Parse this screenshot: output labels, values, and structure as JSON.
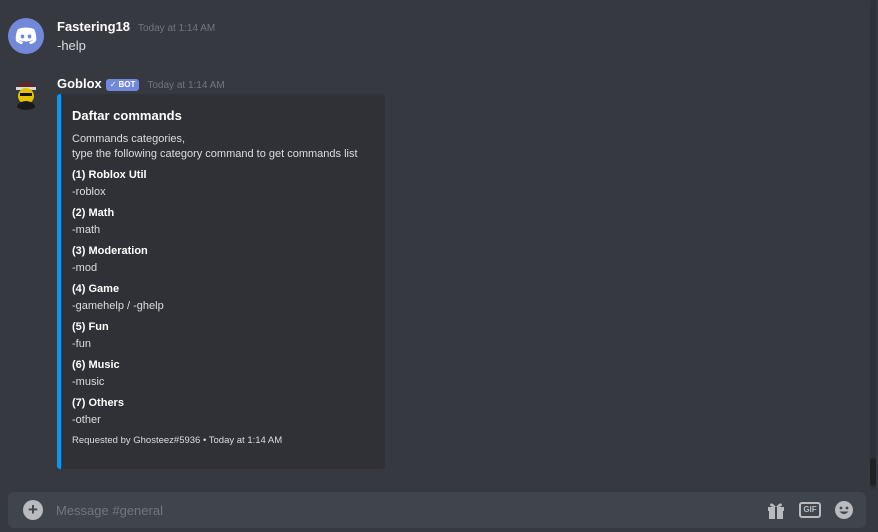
{
  "messages": [
    {
      "username": "Fastering18",
      "timestamp": "Today at 1:14 AM",
      "content": "-help",
      "avatar_icon": "discord-logo-icon"
    },
    {
      "username": "Goblox",
      "bot_tag": "BOT",
      "timestamp": "Today at 1:14 AM",
      "avatar_icon": "bot-avatar-icon",
      "embed": {
        "accent_color": "#0099ff",
        "title": "Daftar commands",
        "description_line1": "Commands categories,",
        "description_line2": "type the following category command to get commands list",
        "fields": [
          {
            "name": "(1) Roblox Util",
            "value": "-roblox"
          },
          {
            "name": "(2) Math",
            "value": "-math"
          },
          {
            "name": "(3) Moderation",
            "value": "-mod"
          },
          {
            "name": "(4) Game",
            "value": "-gamehelp / -ghelp"
          },
          {
            "name": "(5) Fun",
            "value": "-fun"
          },
          {
            "name": "(6) Music",
            "value": "-music"
          },
          {
            "name": "(7) Others",
            "value": "-other"
          }
        ],
        "footer": "Requested by Ghosteez#5936 • Today at 1:14 AM"
      }
    }
  ],
  "composer": {
    "placeholder": "Message #general",
    "gif_label": "GIF"
  },
  "colors": {
    "background": "#36393f",
    "embed_bg": "#2f3136",
    "brand": "#7289da"
  }
}
